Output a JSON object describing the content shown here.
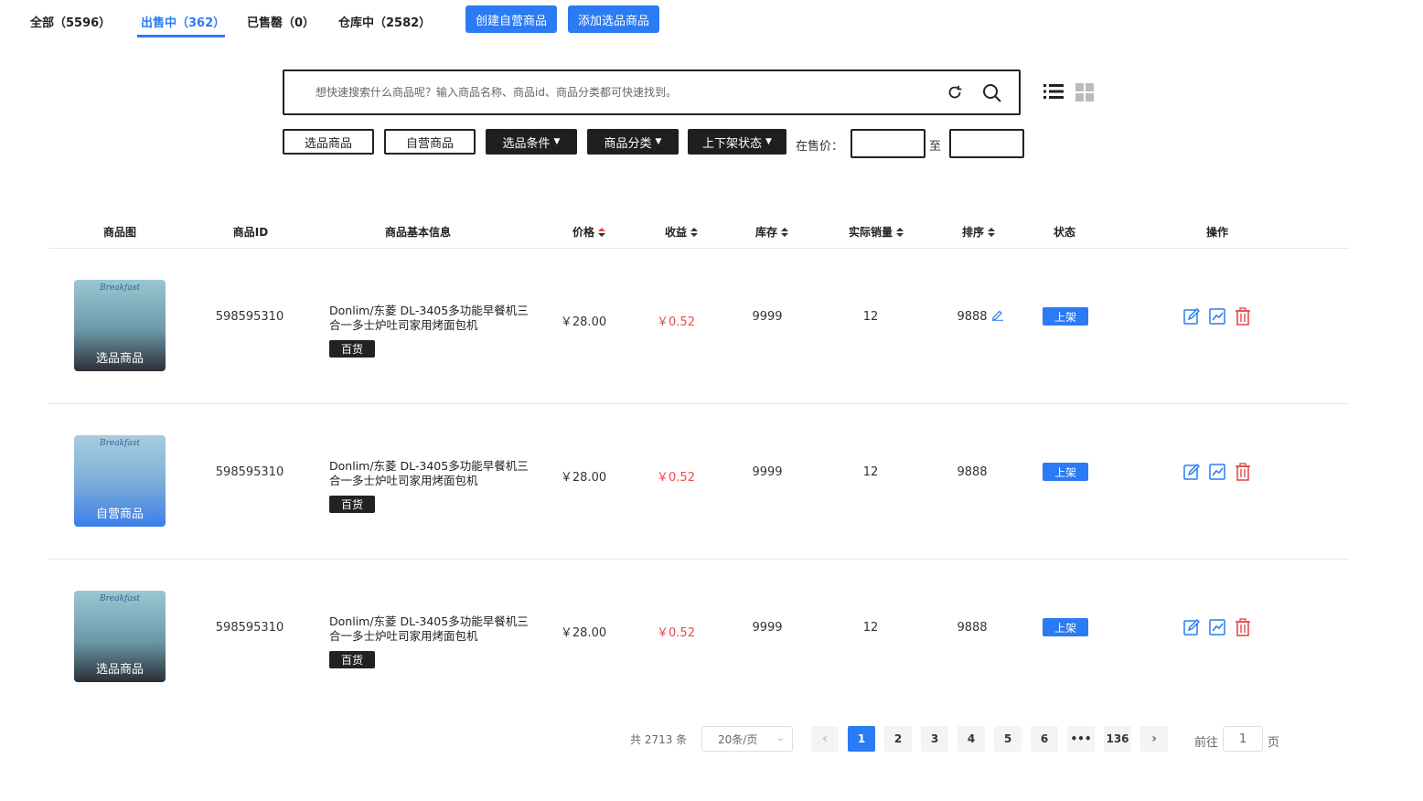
{
  "tabs": [
    {
      "label": "全部（5596）"
    },
    {
      "label": "出售中（362）"
    },
    {
      "label": "已售罄（0）"
    },
    {
      "label": "仓库中（2582）"
    }
  ],
  "actions": {
    "create_self": "创建自营商品",
    "add_selected": "添加选品商品"
  },
  "search": {
    "placeholder": "想快速搜索什么商品呢？输入商品名称、商品id、商品分类都可快速找到。"
  },
  "filters": {
    "selected_goods": "选品商品",
    "self_goods": "自营商品",
    "select_condition": "选品条件",
    "category": "商品分类",
    "shelf_status": "上下架状态",
    "price_label": "在售价：",
    "price_to": "至"
  },
  "table": {
    "headers": {
      "image": "商品图",
      "id": "商品ID",
      "info": "商品基本信息",
      "price": "价格",
      "profit": "收益",
      "stock": "库存",
      "sales": "实际销量",
      "sort": "排序",
      "status": "状态",
      "ops": "操作"
    },
    "rows": [
      {
        "thumb_label": "选品商品",
        "thumb_script": "Breakfast",
        "id": "598595310",
        "title": "Donlim/东菱 DL-3405多功能早餐机三合一多士炉吐司家用烤面包机",
        "tag": "百货",
        "price": "￥28.00",
        "profit": "￥0.52",
        "stock": "9999",
        "sales": "12",
        "sort": "9888",
        "status": "上架"
      },
      {
        "thumb_label": "自营商品",
        "thumb_script": "Breakfast",
        "id": "598595310",
        "title": "Donlim/东菱 DL-3405多功能早餐机三合一多士炉吐司家用烤面包机",
        "tag": "百货",
        "price": "￥28.00",
        "profit": "￥0.52",
        "stock": "9999",
        "sales": "12",
        "sort": "9888",
        "status": "上架"
      },
      {
        "thumb_label": "选品商品",
        "thumb_script": "Breakfast",
        "id": "598595310",
        "title": "Donlim/东菱 DL-3405多功能早餐机三合一多士炉吐司家用烤面包机",
        "tag": "百货",
        "price": "￥28.00",
        "profit": "￥0.52",
        "stock": "9999",
        "sales": "12",
        "sort": "9888",
        "status": "上架"
      }
    ]
  },
  "pagination": {
    "total": "共 2713 条",
    "page_size": "20条/页",
    "pages": [
      "1",
      "2",
      "3",
      "4",
      "5",
      "6",
      "•••",
      "136"
    ],
    "current": "1",
    "goto_label": "前往",
    "goto_value": "1",
    "goto_suffix": "页"
  },
  "colors": {
    "accent": "#2a7bf4",
    "profit": "#e84a4a",
    "dark": "#1f1f1f"
  }
}
